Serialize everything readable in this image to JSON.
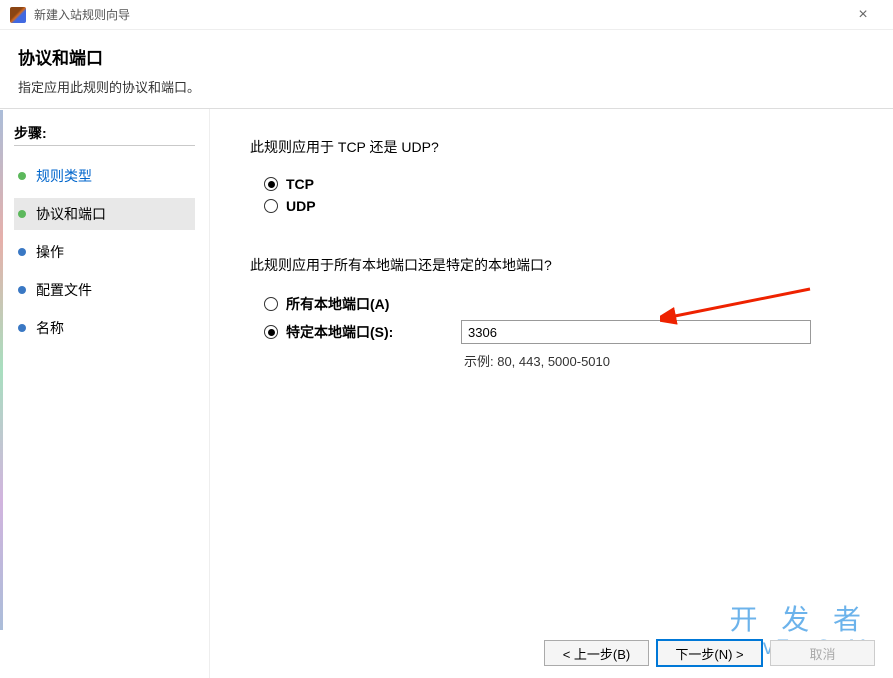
{
  "titlebar": {
    "title": "新建入站规则向导"
  },
  "header": {
    "title": "协议和端口",
    "desc": "指定应用此规则的协议和端口。"
  },
  "sidebar": {
    "steps_label": "步骤:",
    "items": [
      {
        "label": "规则类型",
        "state": "link",
        "bullet": "green"
      },
      {
        "label": "协议和端口",
        "state": "active",
        "bullet": "green"
      },
      {
        "label": "操作",
        "state": "normal",
        "bullet": "blue"
      },
      {
        "label": "配置文件",
        "state": "normal",
        "bullet": "blue"
      },
      {
        "label": "名称",
        "state": "normal",
        "bullet": "blue"
      }
    ]
  },
  "content": {
    "q1": "此规则应用于 TCP 还是 UDP?",
    "tcp_label": "TCP",
    "udp_label": "UDP",
    "protocol_selected": "tcp",
    "q2": "此规则应用于所有本地端口还是特定的本地端口?",
    "all_ports_label": "所有本地端口(A)",
    "specific_ports_label": "特定本地端口(S):",
    "port_scope_selected": "specific",
    "port_value": "3306",
    "port_example": "示例: 80, 443, 5000-5010"
  },
  "footer": {
    "back": "< 上一步(B)",
    "next": "下一步(N) >",
    "cancel": "取消"
  },
  "watermark": {
    "line1": "开 发 者",
    "line2": "DevZe.CoM"
  }
}
